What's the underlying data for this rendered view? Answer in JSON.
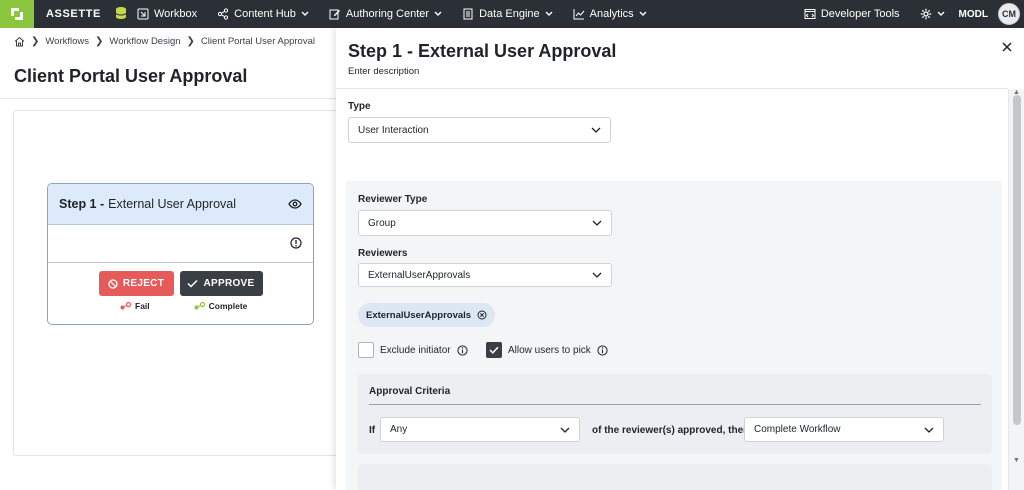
{
  "nav": {
    "brand": "ASSETTE",
    "items": [
      {
        "label": "Workbox"
      },
      {
        "label": "Content Hub"
      },
      {
        "label": "Authoring Center"
      },
      {
        "label": "Data Engine"
      },
      {
        "label": "Analytics"
      }
    ],
    "developer_tools": "Developer Tools",
    "org": "MODL",
    "avatar_initials": "CM"
  },
  "breadcrumb": [
    "Workflows",
    "Workflow Design",
    "Client Portal User Approval"
  ],
  "page_title": "Client Portal User Approval",
  "step_card": {
    "step_label": "Step 1 -",
    "step_name": "External User Approval",
    "reject_label": "REJECT",
    "approve_label": "APPROVE",
    "fail_label": "Fail",
    "complete_label": "Complete"
  },
  "panel": {
    "title": "Step 1 - External User Approval",
    "description": "Enter description",
    "type_label": "Type",
    "type_value": "User Interaction",
    "reviewer_type_label": "Reviewer Type",
    "reviewer_type_value": "Group",
    "reviewers_label": "Reviewers",
    "reviewers_value": "ExternalUserApprovals",
    "chip_label": "ExternalUserApprovals",
    "exclude_initiator_label": "Exclude initiator",
    "exclude_initiator_checked": false,
    "allow_pick_label": "Allow users to pick",
    "allow_pick_checked": true,
    "criteria": {
      "title": "Approval Criteria",
      "if_label": "If",
      "if_value": "Any",
      "middle_text": "of the reviewer(s) approved, then",
      "then_value": "Complete Workflow"
    }
  },
  "colors": {
    "nav_bg": "#2b3036",
    "logo_green": "#8cc63f",
    "reject_red": "#e75a5a",
    "approve_dark": "#3a3f46",
    "step_header_blue": "#ddeaf9"
  }
}
